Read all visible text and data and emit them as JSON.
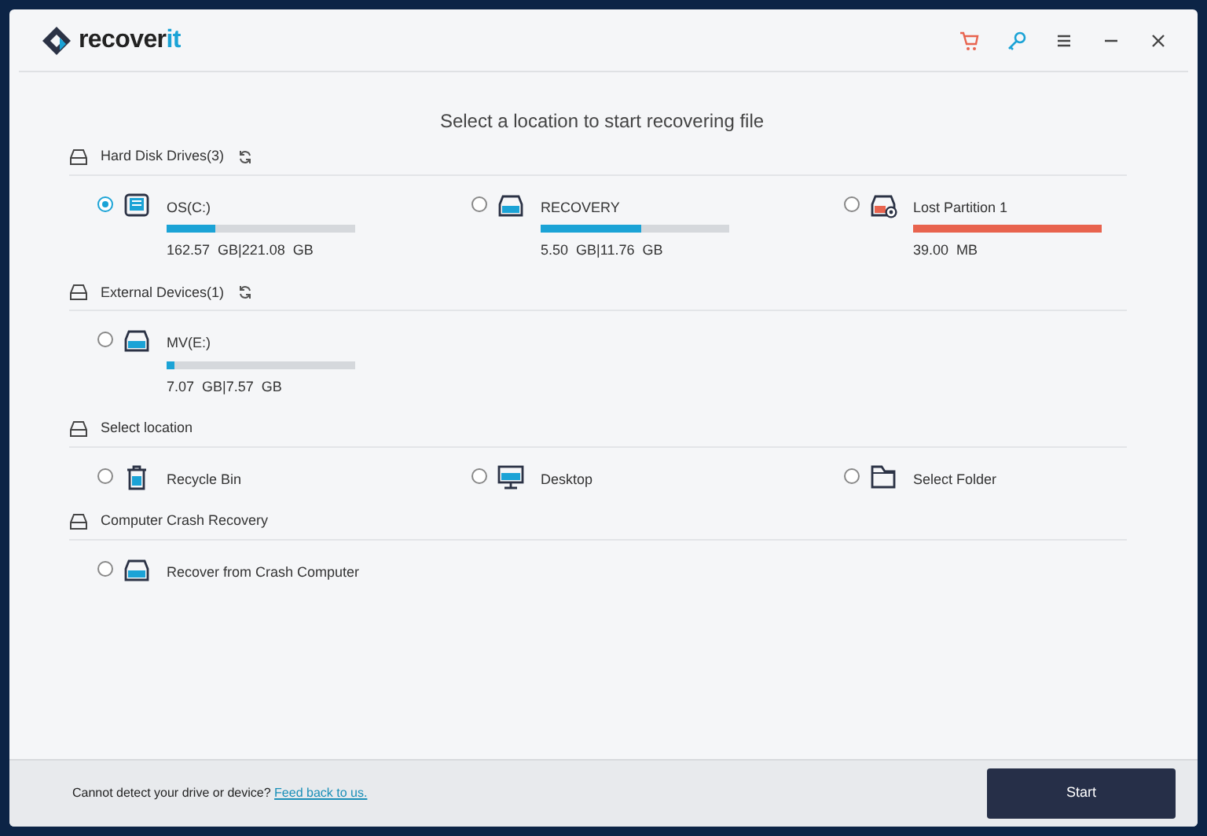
{
  "window": {
    "app_name": "recoverit"
  },
  "heading": "Select a location to start recovering file",
  "sections": [
    {
      "title": "Hard Disk Drives(3)",
      "refresh": true,
      "items": [
        {
          "kind": "system",
          "label": "OS(C:)",
          "selected": true,
          "level": 0.26,
          "size": "162.57  GB|221.08  GB"
        },
        {
          "kind": "volume",
          "label": "RECOVERY",
          "selected": false,
          "level": 0.53,
          "size": "5.50  GB|11.76  GB"
        },
        {
          "kind": "lost",
          "label": "Lost Partition 1",
          "selected": false,
          "level": 1,
          "size": "39.00  MB"
        }
      ]
    },
    {
      "title": "External Devices(1)",
      "refresh": true,
      "items": [
        {
          "kind": "volume",
          "label": "MV(E:)",
          "selected": false,
          "level": 0.04,
          "size": "7.07  GB|7.57  GB"
        }
      ]
    },
    {
      "title": "Select location",
      "refresh": false,
      "items": [
        {
          "kind": "bin",
          "label": "Recycle Bin",
          "selected": false
        },
        {
          "kind": "desktop",
          "label": "Desktop",
          "selected": false
        },
        {
          "kind": "folder",
          "label": "Select Folder",
          "selected": false
        }
      ]
    },
    {
      "title": "Computer Crash Recovery",
      "refresh": false,
      "items": [
        {
          "kind": "crash",
          "label": "Recover from Crash Computer",
          "selected": false
        }
      ]
    }
  ],
  "footer": {
    "note": "Cannot detect your drive or device?",
    "link": "Feed back to us.",
    "button": "Start"
  }
}
